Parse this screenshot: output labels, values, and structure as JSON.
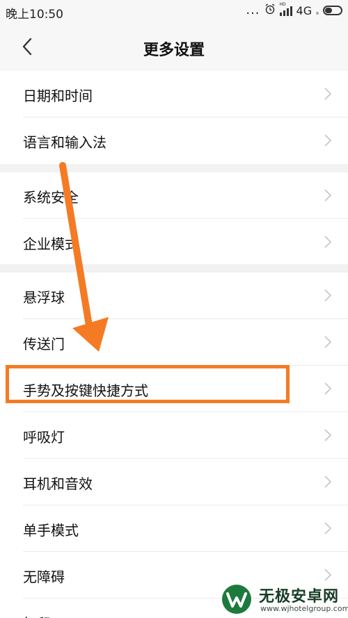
{
  "status": {
    "time": "晚上10:50",
    "dots": "...",
    "hd": "HD",
    "network": "4G",
    "tiny": "ıı"
  },
  "header": {
    "title": "更多设置"
  },
  "rows": [
    {
      "label": "日期和时间"
    },
    {
      "label": "语言和输入法"
    },
    {
      "label": "系统安全"
    },
    {
      "label": "企业模式"
    },
    {
      "label": "悬浮球"
    },
    {
      "label": "传送门"
    },
    {
      "label": "手势及按键快捷方式"
    },
    {
      "label": "呼吸灯"
    },
    {
      "label": "耳机和音效"
    },
    {
      "label": "单手模式"
    },
    {
      "label": "无障碍"
    },
    {
      "label": "打印"
    }
  ],
  "watermark": {
    "title": "无极安卓网",
    "url": "www.wjhotelgroup.com"
  },
  "colors": {
    "annotation": "#f47b24",
    "watermark_green": "#1e7a3c"
  }
}
